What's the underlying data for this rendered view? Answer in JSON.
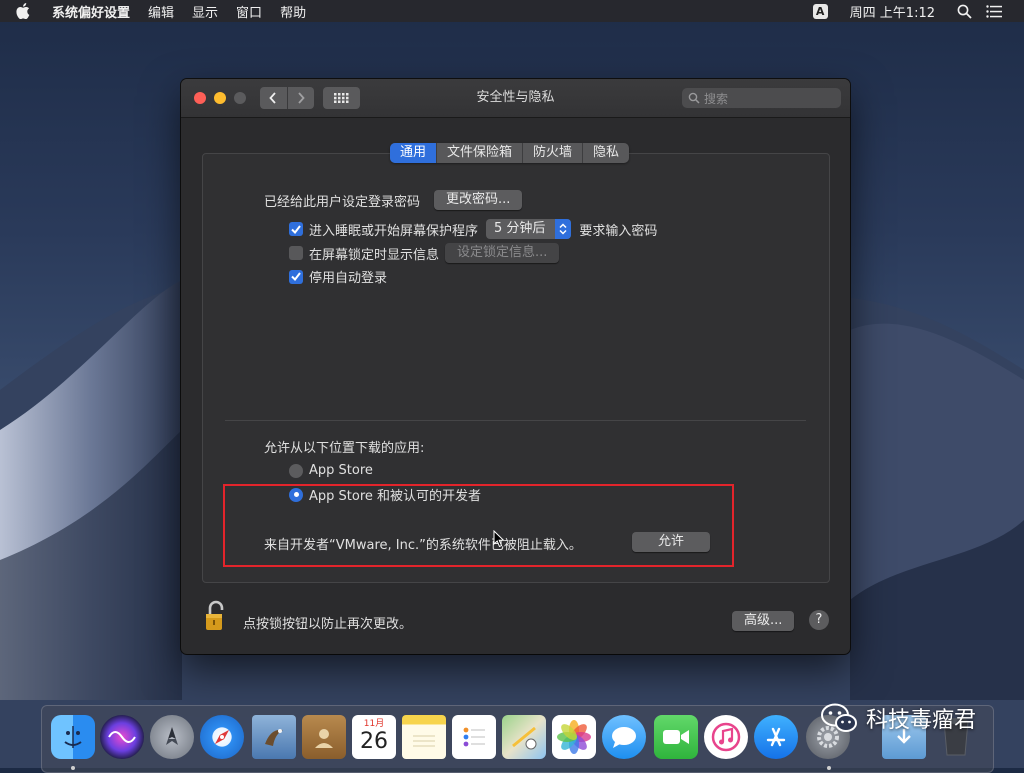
{
  "menubar": {
    "app_name": "系统偏好设置",
    "items": [
      "编辑",
      "显示",
      "窗口",
      "帮助"
    ],
    "input_badge": "A",
    "clock": "周四 上午1:12"
  },
  "window": {
    "title": "安全性与隐私",
    "search_placeholder": "搜索",
    "tabs": [
      {
        "label": "通用",
        "active": true
      },
      {
        "label": "文件保险箱",
        "active": false
      },
      {
        "label": "防火墙",
        "active": false
      },
      {
        "label": "隐私",
        "active": false
      }
    ],
    "general": {
      "password_label": "已经给此用户设定登录密码",
      "change_password_button": "更改密码...",
      "require_password": {
        "checked": true,
        "label_before": "进入睡眠或开始屏幕保护程序",
        "delay_value": "5 分钟后",
        "label_after": "要求输入密码"
      },
      "lock_message": {
        "checked": false,
        "label": "在屏幕锁定时显示信息",
        "button": "设定锁定信息..."
      },
      "disable_auto_login": {
        "checked": true,
        "label": "停用自动登录"
      },
      "allow_apps_label": "允许从以下位置下载的应用:",
      "radio_app_store": {
        "label": "App Store",
        "selected": false
      },
      "radio_app_store_devs": {
        "label": "App Store 和被认可的开发者",
        "selected": true
      },
      "blocked_message": "来自开发者“VMware, Inc.”的系统软件已被阻止载入。",
      "allow_button": "允许"
    },
    "footer": {
      "lock_text": "点按锁按钮以防止再次更改。",
      "advanced_button": "高级...",
      "help_button": "?"
    }
  },
  "dock": {
    "calendar_month": "11月",
    "calendar_day": "26",
    "apps": [
      "finder-icon",
      "siri-icon",
      "launchpad-icon",
      "safari-icon",
      "mail-icon",
      "contacts-icon",
      "calendar-icon",
      "notes-icon",
      "reminders-icon",
      "maps-icon",
      "photos-icon",
      "messages-icon",
      "facetime-icon",
      "itunes-icon",
      "appstore-icon",
      "system-preferences-icon",
      "downloads-icon",
      "trash-icon"
    ]
  },
  "watermark": "科技毒瘤君"
}
